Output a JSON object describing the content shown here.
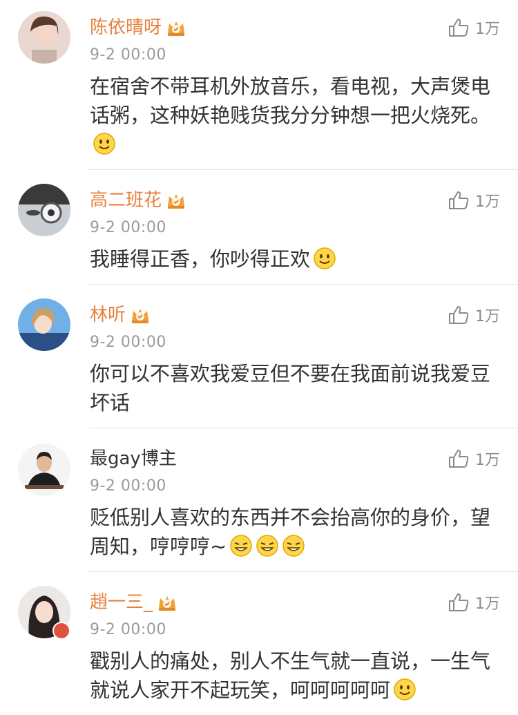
{
  "comments": [
    {
      "name": "陈依晴呀",
      "time": "9-2 00:00",
      "likes": "1万",
      "text": "在宿舍不带耳机外放音乐，看电视，大声煲电话粥，这种妖艳贱货我分分钟想一把火烧死。",
      "emojis": "smile-emoji"
    },
    {
      "name": "高二班花",
      "time": "9-2 00:00",
      "likes": "1万",
      "text": "我睡得正香，你吵得正欢",
      "emojis": "smile-emoji"
    },
    {
      "name": "林听",
      "time": "9-2 00:00",
      "likes": "1万",
      "text": "你可以不喜欢我爱豆但不要在我面前说我爱豆坏话"
    },
    {
      "name": "最gay博主",
      "time": "9-2 00:00",
      "likes": "1万",
      "text": "贬低别人喜欢的东西并不会抬高你的身价，望周知，哼哼哼~",
      "emojis": "laugh-emoji x3"
    },
    {
      "name": "趙一三_",
      "time": "9-2 00:00",
      "likes": "1万",
      "text": "戳别人的痛处，别人不生气就一直说，一生气就说人家开不起玩笑，呵呵呵呵呵",
      "emojis": "smile-emoji"
    }
  ],
  "colors": {
    "vip_name": "#e8803a",
    "plain_name": "#333333",
    "meta": "#9a9a9a",
    "divider": "#e4e4e4",
    "badge": "#e0523f"
  },
  "icons": [
    "thumbs-up-icon",
    "crown-vip-icon",
    "smile-emoji",
    "laugh-emoji"
  ]
}
